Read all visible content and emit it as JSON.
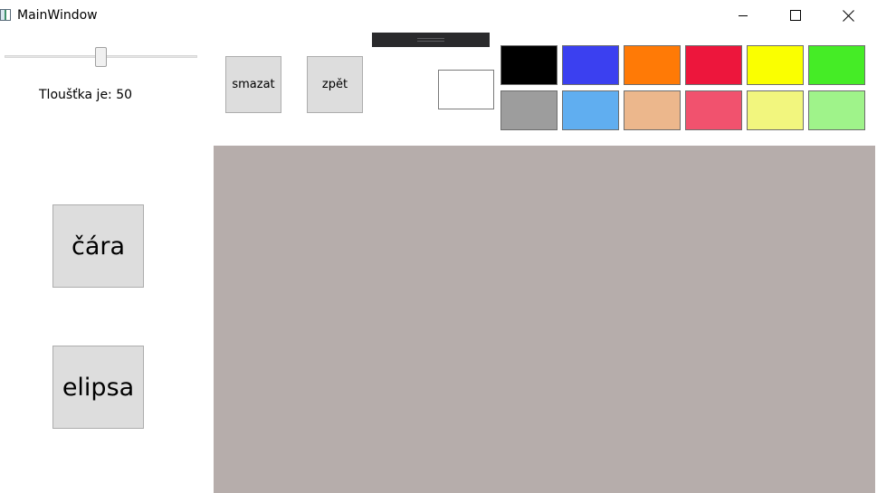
{
  "window": {
    "title": "MainWindow"
  },
  "controls": {
    "minimize_icon": "minimize-icon",
    "maximize_icon": "maximize-icon",
    "close_icon": "close-icon"
  },
  "thickness": {
    "label": "Tloušťka je: 50",
    "slider_value_fraction": 0.5
  },
  "toolbar": {
    "clear_label": "smazat",
    "undo_label": "zpět"
  },
  "tools": {
    "line_label": "čára",
    "ellipse_label": "elipsa"
  },
  "colors": {
    "current": "#ffffff",
    "canvas_background": "#b6adab",
    "grip_bar": "#2a2a2c",
    "palette_row1": [
      "#000000",
      "#3b40f0",
      "#ff7a06",
      "#ed163c",
      "#faff00",
      "#45ec26"
    ],
    "palette_row2": [
      "#9d9d9d",
      "#60aef0",
      "#ecb78c",
      "#f1526e",
      "#f2f67e",
      "#9ff38a"
    ]
  }
}
